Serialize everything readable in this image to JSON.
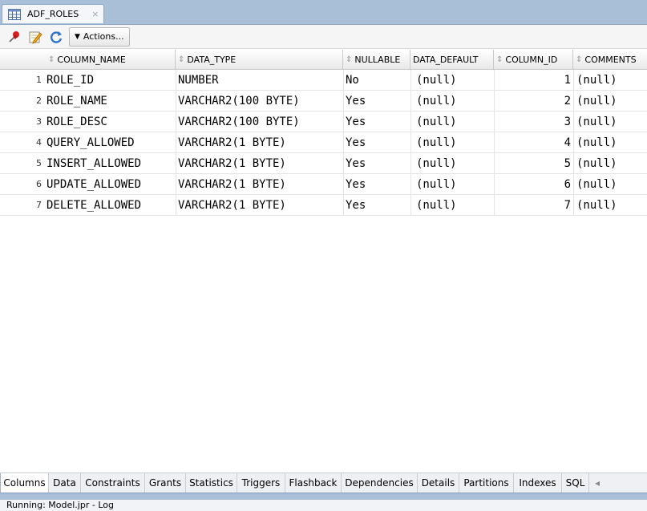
{
  "editor_tab": {
    "label": "ADF_ROLES",
    "close": "×"
  },
  "toolbar": {
    "actions_label": "Actions..."
  },
  "table": {
    "headers": [
      "COLUMN_NAME",
      "DATA_TYPE",
      "NULLABLE",
      "DATA_DEFAULT",
      "COLUMN_ID",
      "COMMENTS"
    ],
    "rows": [
      [
        "1",
        "ROLE_ID",
        "NUMBER",
        "No",
        "(null)",
        "1",
        "(null)"
      ],
      [
        "2",
        "ROLE_NAME",
        "VARCHAR2(100 BYTE)",
        "Yes",
        "(null)",
        "2",
        "(null)"
      ],
      [
        "3",
        "ROLE_DESC",
        "VARCHAR2(100 BYTE)",
        "Yes",
        "(null)",
        "3",
        "(null)"
      ],
      [
        "4",
        "QUERY_ALLOWED",
        "VARCHAR2(1 BYTE)",
        "Yes",
        "(null)",
        "4",
        "(null)"
      ],
      [
        "5",
        "INSERT_ALLOWED",
        "VARCHAR2(1 BYTE)",
        "Yes",
        "(null)",
        "5",
        "(null)"
      ],
      [
        "6",
        "UPDATE_ALLOWED",
        "VARCHAR2(1 BYTE)",
        "Yes",
        "(null)",
        "6",
        "(null)"
      ],
      [
        "7",
        "DELETE_ALLOWED",
        "VARCHAR2(1 BYTE)",
        "Yes",
        "(null)",
        "7",
        "(null)"
      ]
    ]
  },
  "bottom_tabs": [
    "Columns",
    "Data",
    "Constraints",
    "Grants",
    "Statistics",
    "Triggers",
    "Flashback",
    "Dependencies",
    "Details",
    "Partitions",
    "Indexes",
    "SQL"
  ],
  "active_bottom_tab": "Columns",
  "status": {
    "text": "Running: Model.jpr - Log"
  }
}
